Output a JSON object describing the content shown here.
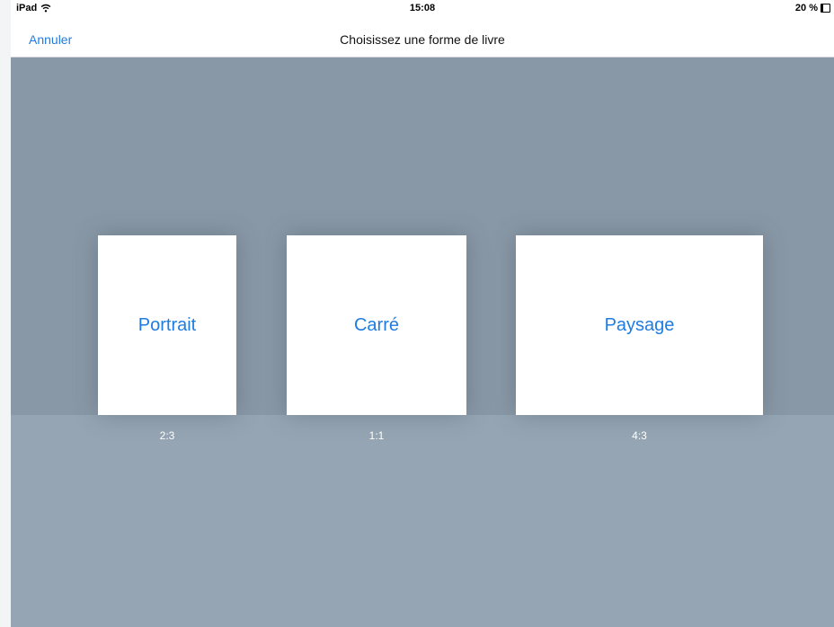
{
  "status_bar": {
    "device": "iPad",
    "time": "15:08",
    "battery": "20 %",
    "battery_level": 0.2
  },
  "nav": {
    "cancel_label": "Annuler",
    "title": "Choisissez une forme de livre"
  },
  "shapes": [
    {
      "label": "Portrait",
      "ratio": "2:3"
    },
    {
      "label": "Carré",
      "ratio": "1:1"
    },
    {
      "label": "Paysage",
      "ratio": "4:3"
    }
  ],
  "colors": {
    "accent": "#1f7ce2",
    "upper_background": "#8998a6",
    "lower_background": "#95a5b3"
  },
  "icons": [
    "wifi-icon",
    "battery-icon"
  ]
}
